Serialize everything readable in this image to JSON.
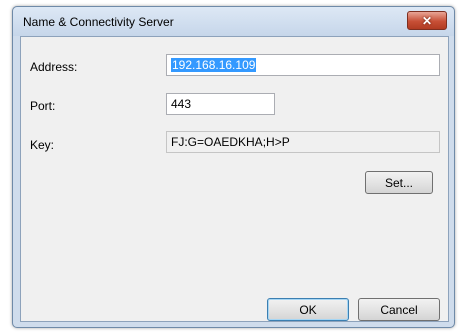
{
  "window": {
    "title": "Name & Connectivity Server",
    "close_glyph": "✕"
  },
  "form": {
    "address": {
      "label": "Address:",
      "value": "192.168.16.109"
    },
    "port": {
      "label": "Port:",
      "value": "443"
    },
    "key": {
      "label": "Key:",
      "value": "FJ:G=OAEDKHA;H>P"
    }
  },
  "buttons": {
    "set": "Set...",
    "ok": "OK",
    "cancel": "Cancel"
  }
}
